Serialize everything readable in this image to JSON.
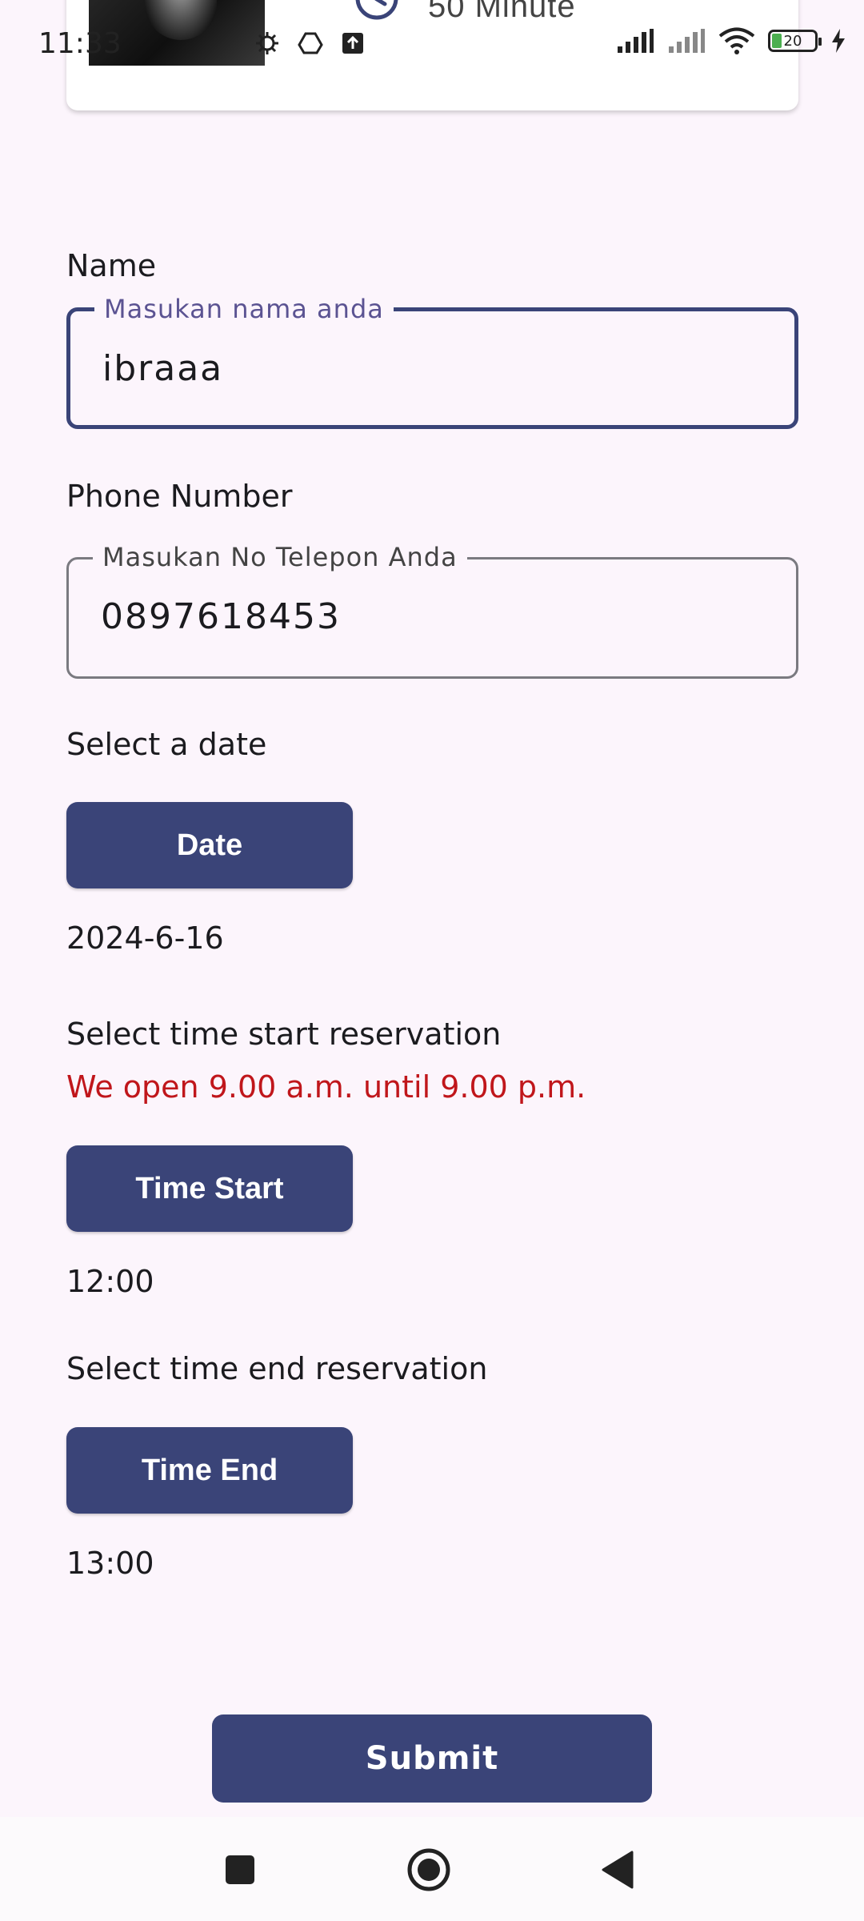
{
  "status_bar": {
    "time": "11:33",
    "battery_level": "20"
  },
  "service_card": {
    "duration": "50  Minute"
  },
  "form": {
    "name_label": "Name",
    "name_field": {
      "legend": "Masukan nama anda",
      "value": "ibraaa"
    },
    "phone_label": "Phone Number",
    "phone_field": {
      "legend": "Masukan No Telepon Anda",
      "value": "0897618453"
    },
    "date_label": "Select a date",
    "date_button": "Date",
    "date_value": "2024-6-16",
    "time_start_label": "Select time start reservation",
    "opening_notice": "We open 9.00 a.m. until 9.00 p.m.",
    "time_start_button": "Time Start",
    "time_start_value": "12:00",
    "time_end_label": "Select time end reservation",
    "time_end_button": "Time End",
    "time_end_value": "13:00",
    "submit_button": "Submit"
  },
  "colors": {
    "primary": "#3a4478",
    "background": "#fcf5fc",
    "notice": "#c0161b",
    "legend_focused": "#5b5392"
  },
  "icons": {
    "clock": "clock-icon",
    "nav_recents": "square-icon",
    "nav_home": "circle-icon",
    "nav_back": "triangle-back-icon"
  }
}
